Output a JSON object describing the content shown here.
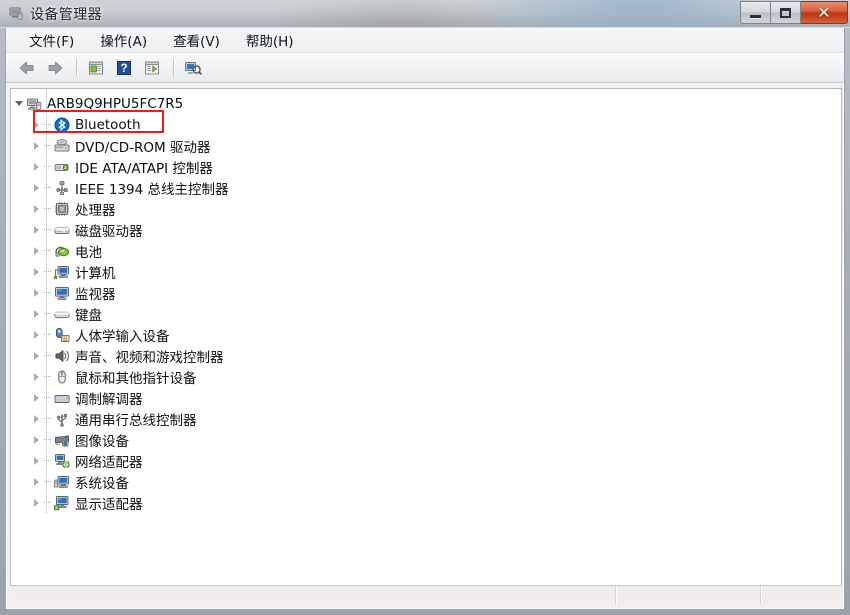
{
  "window": {
    "title": "设备管理器",
    "icon": "device-manager-icon",
    "controls": {
      "minimize": "–",
      "maximize": "□",
      "close": "✕"
    }
  },
  "menubar": {
    "items": [
      {
        "label": "文件(F)",
        "name": "menu-file"
      },
      {
        "label": "操作(A)",
        "name": "menu-action"
      },
      {
        "label": "查看(V)",
        "name": "menu-view"
      },
      {
        "label": "帮助(H)",
        "name": "menu-help"
      }
    ]
  },
  "toolbar": {
    "buttons": [
      {
        "name": "back-icon",
        "glyph": "back"
      },
      {
        "name": "forward-icon",
        "glyph": "forward"
      },
      {
        "name": "separator",
        "glyph": "sep"
      },
      {
        "name": "properties-icon",
        "glyph": "props"
      },
      {
        "name": "help-icon",
        "glyph": "help"
      },
      {
        "name": "show-hide-icon",
        "glyph": "show"
      },
      {
        "name": "separator",
        "glyph": "sep"
      },
      {
        "name": "scan-hardware-changes-icon",
        "glyph": "scan"
      }
    ]
  },
  "tree": {
    "root": {
      "label": "ARB9Q9HPU5FC7R5",
      "icon": "computer-icon",
      "expanded": true
    },
    "nodes": [
      {
        "label": "Bluetooth",
        "icon": "bluetooth-icon",
        "highlighted": true
      },
      {
        "label": "DVD/CD-ROM 驱动器",
        "icon": "dvd-drive-icon",
        "highlighted": false
      },
      {
        "label": "IDE ATA/ATAPI 控制器",
        "icon": "ide-controller-icon",
        "highlighted": false
      },
      {
        "label": "IEEE 1394 总线主控制器",
        "icon": "ieee1394-icon",
        "highlighted": false
      },
      {
        "label": "处理器",
        "icon": "processor-icon",
        "highlighted": false
      },
      {
        "label": "磁盘驱动器",
        "icon": "disk-drive-icon",
        "highlighted": false
      },
      {
        "label": "电池",
        "icon": "battery-icon",
        "highlighted": false
      },
      {
        "label": "计算机",
        "icon": "computer-node-icon",
        "highlighted": false
      },
      {
        "label": "监视器",
        "icon": "monitor-icon",
        "highlighted": false
      },
      {
        "label": "键盘",
        "icon": "keyboard-icon",
        "highlighted": false
      },
      {
        "label": "人体学输入设备",
        "icon": "hid-icon",
        "highlighted": false
      },
      {
        "label": "声音、视频和游戏控制器",
        "icon": "sound-icon",
        "highlighted": false
      },
      {
        "label": "鼠标和其他指针设备",
        "icon": "mouse-icon",
        "highlighted": false
      },
      {
        "label": "调制解调器",
        "icon": "modem-icon",
        "highlighted": false
      },
      {
        "label": "通用串行总线控制器",
        "icon": "usb-icon",
        "highlighted": false
      },
      {
        "label": "图像设备",
        "icon": "imaging-icon",
        "highlighted": false
      },
      {
        "label": "网络适配器",
        "icon": "network-icon",
        "highlighted": false
      },
      {
        "label": "系统设备",
        "icon": "system-device-icon",
        "highlighted": false
      },
      {
        "label": "显示适配器",
        "icon": "display-adapter-icon",
        "highlighted": false
      }
    ]
  },
  "statusbar": {
    "panes": [
      "",
      "",
      ""
    ]
  },
  "colors": {
    "highlight_border": "#ee1b19",
    "bluetooth_blue": "#0a6fd8",
    "close_button_red": "#d95b33",
    "tree_background": "#ffffff",
    "client_background": "#f0efee"
  }
}
